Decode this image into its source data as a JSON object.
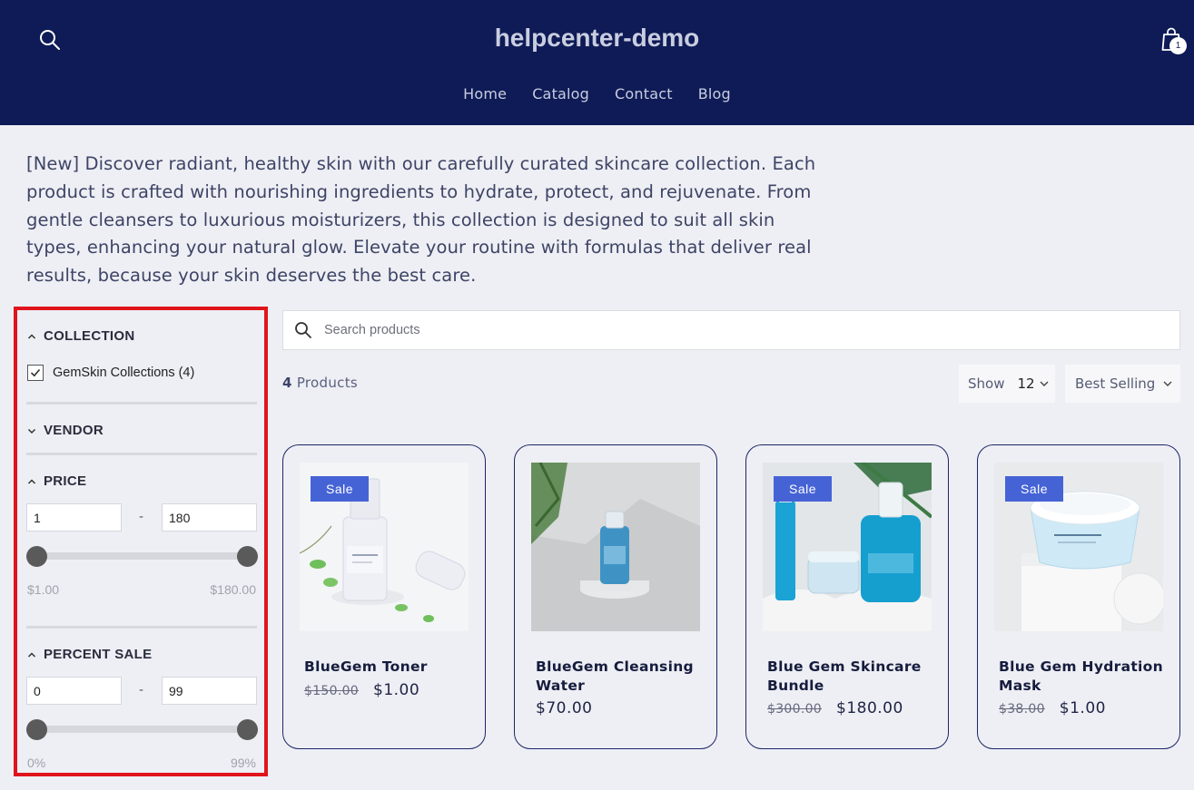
{
  "header": {
    "site_title": "helpcenter-demo",
    "cart_count": "1",
    "nav": [
      "Home",
      "Catalog",
      "Contact",
      "Blog"
    ]
  },
  "description": "[New] Discover radiant, healthy skin with our carefully curated skincare collection. Each product is crafted with nourishing ingredients to hydrate, protect, and rejuvenate. From gentle cleansers to luxurious moisturizers, this collection is designed to suit all skin types, enhancing your natural glow. Elevate your routine with formulas that deliver real results, because your skin deserves the best care.",
  "filters": {
    "collection": {
      "title": "COLLECTION",
      "expanded": true,
      "option_label": "GemSkin Collections (4)",
      "checked": true
    },
    "vendor": {
      "title": "VENDOR",
      "expanded": false
    },
    "price": {
      "title": "PRICE",
      "min_value": "1",
      "max_value": "180",
      "separator": "-",
      "min_label": "$1.00",
      "max_label": "$180.00",
      "range_low_fraction": 0,
      "range_high_fraction": 1
    },
    "percent_sale": {
      "title": "PERCENT SALE",
      "min_value": "0",
      "max_value": "99",
      "separator": "-",
      "min_label": "0%",
      "max_label": "99%",
      "range_low_fraction": 0,
      "range_high_fraction": 1
    }
  },
  "search": {
    "placeholder": "Search products"
  },
  "results": {
    "count": "4",
    "count_label": "Products"
  },
  "show": {
    "label": "Show",
    "value": "12"
  },
  "sort": {
    "value": "Best Selling"
  },
  "products": [
    {
      "name": "BlueGem Toner",
      "sale_badge": "Sale",
      "old_price": "$150.00",
      "price": "$1.00"
    },
    {
      "name": "BlueGem Cleansing Water",
      "sale_badge": "",
      "old_price": "",
      "price": "$70.00"
    },
    {
      "name": "Blue Gem Skincare Bundle",
      "sale_badge": "Sale",
      "old_price": "$300.00",
      "price": "$180.00"
    },
    {
      "name": "Blue Gem Hydration Mask",
      "sale_badge": "Sale",
      "old_price": "$38.00",
      "price": "$1.00"
    }
  ],
  "colors": {
    "header_bg": "#0e1b56",
    "page_bg": "#eeeff4",
    "sale_badge": "#4663d6",
    "highlight_border": "#e0141c",
    "card_border": "#1c2566"
  }
}
